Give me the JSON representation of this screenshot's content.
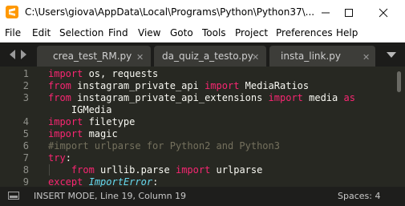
{
  "window": {
    "title": "C:\\Users\\giova\\AppData\\Local\\Programs\\Python\\Python37\\...",
    "icon": "sublime-text-icon"
  },
  "menu": [
    "File",
    "Edit",
    "Selection",
    "Find",
    "View",
    "Goto",
    "Tools",
    "Project",
    "Preferences",
    "Help"
  ],
  "tabs": [
    {
      "label": "crea_test_RM.py",
      "active": false
    },
    {
      "label": "da_quiz_a_testo.py",
      "active": false
    },
    {
      "label": "insta_link.py",
      "active": true
    }
  ],
  "editor": {
    "gutter": [
      "1",
      "2",
      "3",
      "",
      "4",
      "5",
      "6",
      "7",
      "8",
      "9"
    ],
    "lines": [
      [
        {
          "t": "import",
          "c": "kw"
        },
        {
          "t": " os, requests",
          "c": ""
        }
      ],
      [
        {
          "t": "from",
          "c": "kw"
        },
        {
          "t": " instagram_private_api ",
          "c": ""
        },
        {
          "t": "import",
          "c": "kw"
        },
        {
          "t": " MediaRatios",
          "c": ""
        }
      ],
      [
        {
          "t": "from",
          "c": "kw"
        },
        {
          "t": " instagram_private_api_extensions ",
          "c": ""
        },
        {
          "t": "import",
          "c": "kw"
        },
        {
          "t": " media ",
          "c": ""
        },
        {
          "t": "as",
          "c": "kw"
        }
      ],
      [
        {
          "t": "    IGMedia",
          "c": ""
        }
      ],
      [
        {
          "t": "import",
          "c": "kw"
        },
        {
          "t": " filetype",
          "c": ""
        }
      ],
      [
        {
          "t": "import",
          "c": "kw"
        },
        {
          "t": " magic",
          "c": ""
        }
      ],
      [
        {
          "t": "#import urlparse for Python2 and Python3",
          "c": "cm"
        }
      ],
      [
        {
          "t": "try",
          "c": "kw"
        },
        {
          "t": ":",
          "c": ""
        }
      ],
      [
        {
          "t": "    ",
          "c": ""
        },
        {
          "t": "from",
          "c": "kw"
        },
        {
          "t": " urllib.parse ",
          "c": ""
        },
        {
          "t": "import",
          "c": "kw"
        },
        {
          "t": " urlparse",
          "c": ""
        }
      ],
      [
        {
          "t": "except",
          "c": "kw"
        },
        {
          "t": " ",
          "c": ""
        },
        {
          "t": "ImportError",
          "c": "ex"
        },
        {
          "t": ":",
          "c": ""
        }
      ]
    ]
  },
  "status": {
    "mode": "INSERT MODE, Line 19, Column 19",
    "indent": "Spaces: 4"
  },
  "colors": {
    "editor_bg": "#272822",
    "keyword": "#f92672",
    "comment": "#75715e",
    "exception": "#66d9ef",
    "text": "#f8f8f2"
  }
}
